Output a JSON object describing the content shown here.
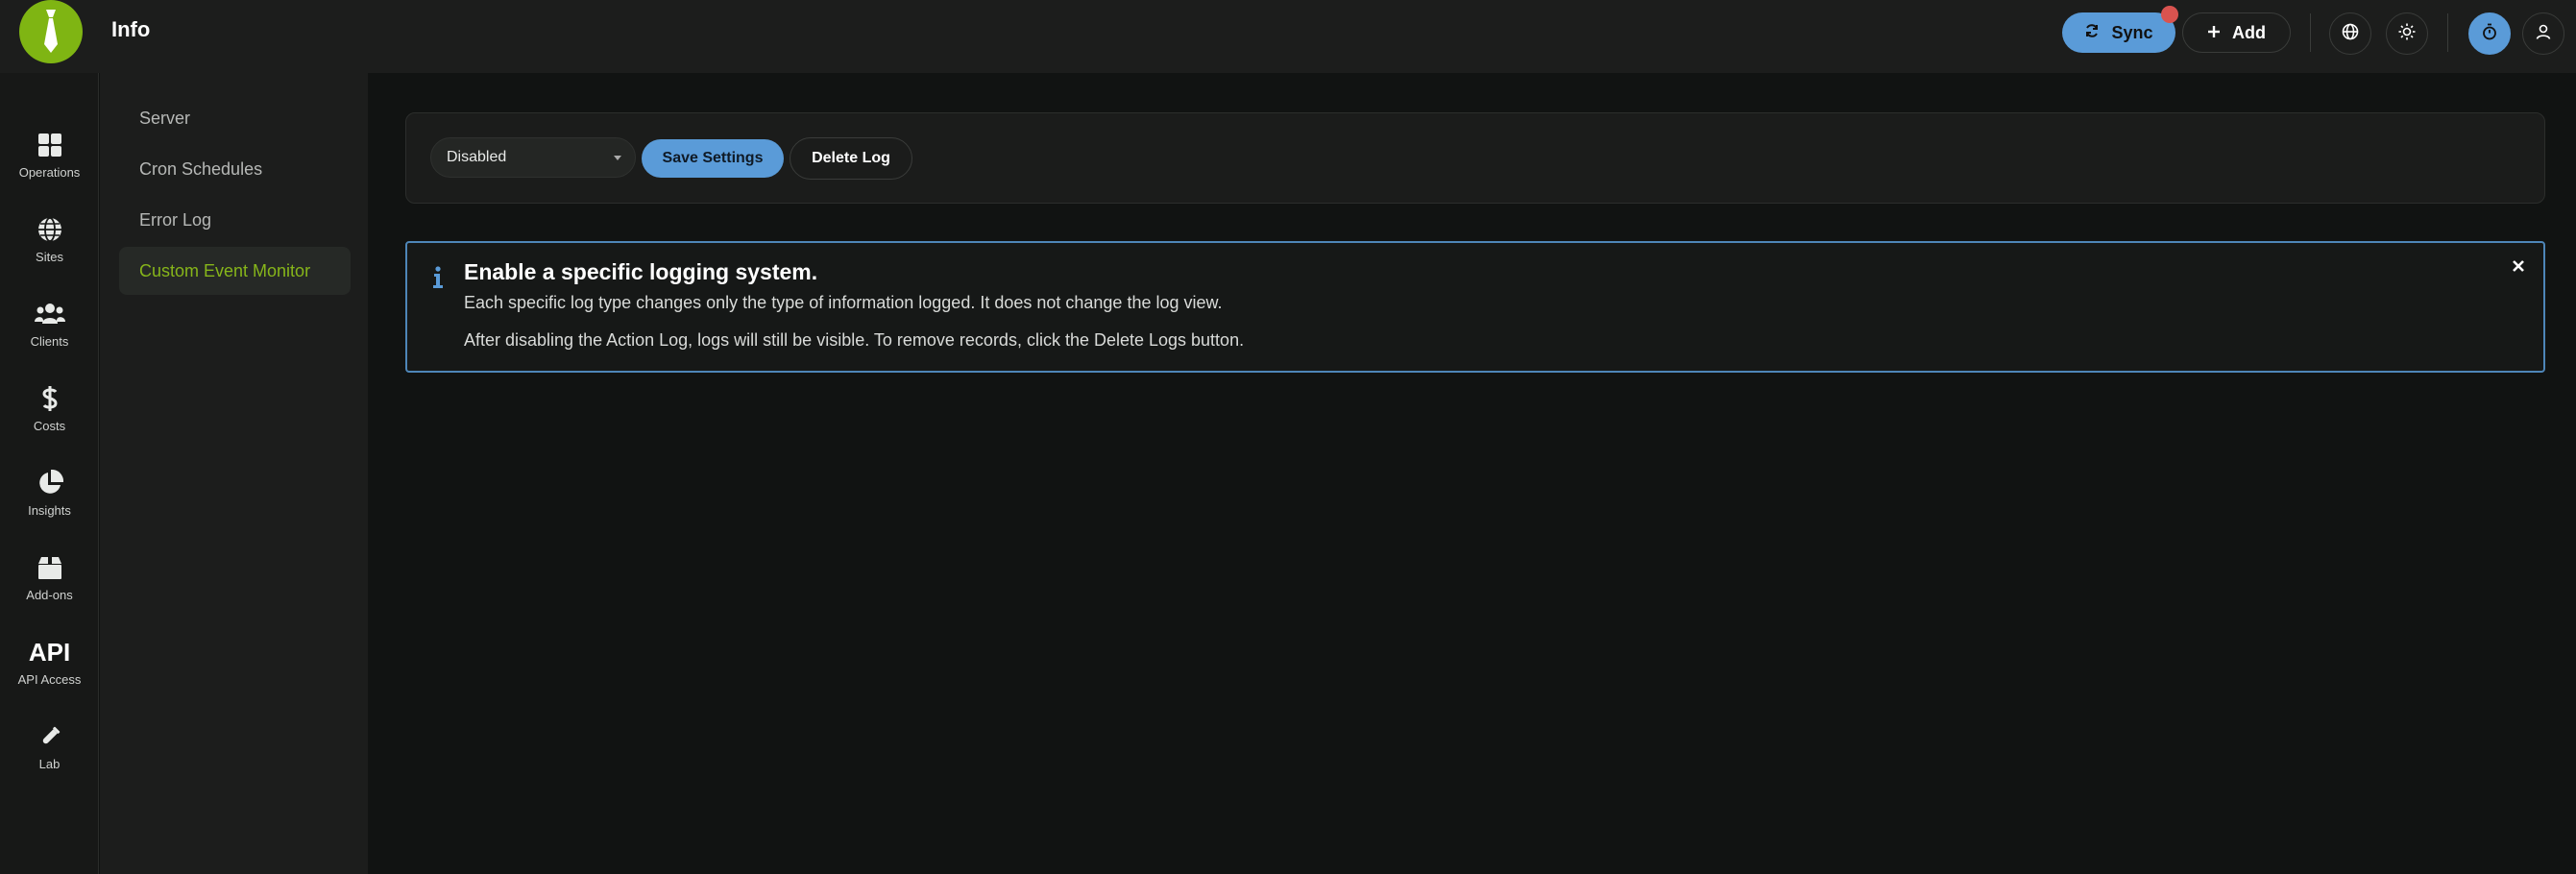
{
  "header": {
    "title": "Info",
    "sync_label": "Sync",
    "add_label": "Add"
  },
  "leftnav": {
    "items": [
      {
        "label": "Operations",
        "icon": "grid-icon"
      },
      {
        "label": "Sites",
        "icon": "globe-icon"
      },
      {
        "label": "Clients",
        "icon": "users-icon"
      },
      {
        "label": "Costs",
        "icon": "dollar-icon"
      },
      {
        "label": "Insights",
        "icon": "pie-chart-icon"
      },
      {
        "label": "Add-ons",
        "icon": "box-icon"
      },
      {
        "label": "API Access",
        "icon": "api-icon",
        "glyph": "API"
      },
      {
        "label": "Lab",
        "icon": "test-tube-icon"
      }
    ]
  },
  "subnav": {
    "items": [
      {
        "label": "Server"
      },
      {
        "label": "Cron Schedules"
      },
      {
        "label": "Error Log"
      },
      {
        "label": "Custom Event Monitor",
        "active": true
      }
    ]
  },
  "settings": {
    "select_value": "Disabled",
    "save_label": "Save Settings",
    "delete_label": "Delete Log"
  },
  "alert": {
    "title": "Enable a specific logging system.",
    "line1": "Each specific log type changes only the type of information logged. It does not change the log view.",
    "line2": "After disabling the Action Log, logs will still be visible. To remove records, click the Delete Logs button."
  },
  "colors": {
    "accent_blue": "#5a9bd8",
    "brand_green": "#7fb513",
    "active_green": "#86b51a",
    "notify_red": "#d9534f"
  }
}
